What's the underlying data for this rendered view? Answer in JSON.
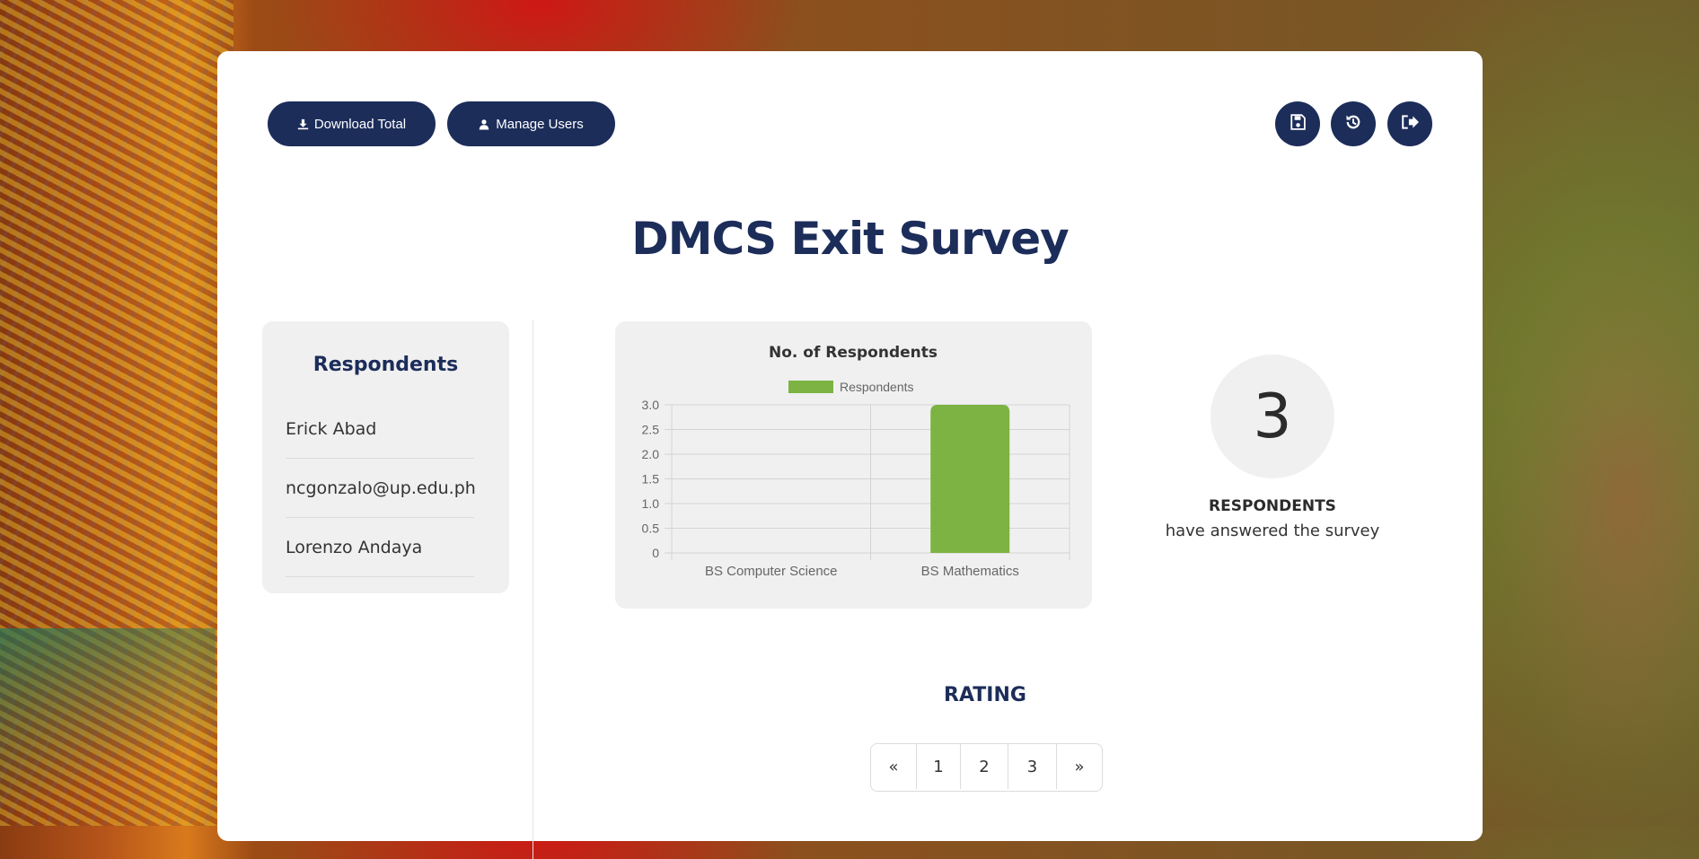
{
  "toolbar": {
    "download_label": "Download Total",
    "manage_label": "Manage Users",
    "icons": {
      "download": "download-icon",
      "user": "user-icon",
      "save": "save-icon",
      "history": "history-icon",
      "logout": "logout-icon"
    }
  },
  "page": {
    "title": "DMCS Exit Survey"
  },
  "respondents_panel": {
    "heading": "Respondents",
    "items": [
      "Erick Abad",
      "ncgonzalo@up.edu.ph",
      "Lorenzo Andaya"
    ]
  },
  "chart_data": {
    "type": "bar",
    "title": "No. of Respondents",
    "categories": [
      "BS Computer Science",
      "BS Mathematics"
    ],
    "series": [
      {
        "name": "Respondents",
        "values": [
          0,
          3
        ],
        "color": "#7cb342"
      }
    ],
    "xlabel": "",
    "ylabel": "",
    "ylim": [
      0,
      3.0
    ],
    "yticks": [
      "0",
      "0.5",
      "1.0",
      "1.5",
      "2.0",
      "2.5",
      "3.0"
    ],
    "grid": true,
    "legend": "top"
  },
  "summary": {
    "count": "3",
    "label": "RESPONDENTS",
    "sub": "have answered the survey"
  },
  "rating": {
    "heading": "RATING",
    "pagination": [
      "«",
      "1",
      "2",
      "3",
      "»"
    ]
  },
  "colors": {
    "primary": "#1c2d5a",
    "panel": "#f0f0f0",
    "bar": "#7cb342"
  }
}
